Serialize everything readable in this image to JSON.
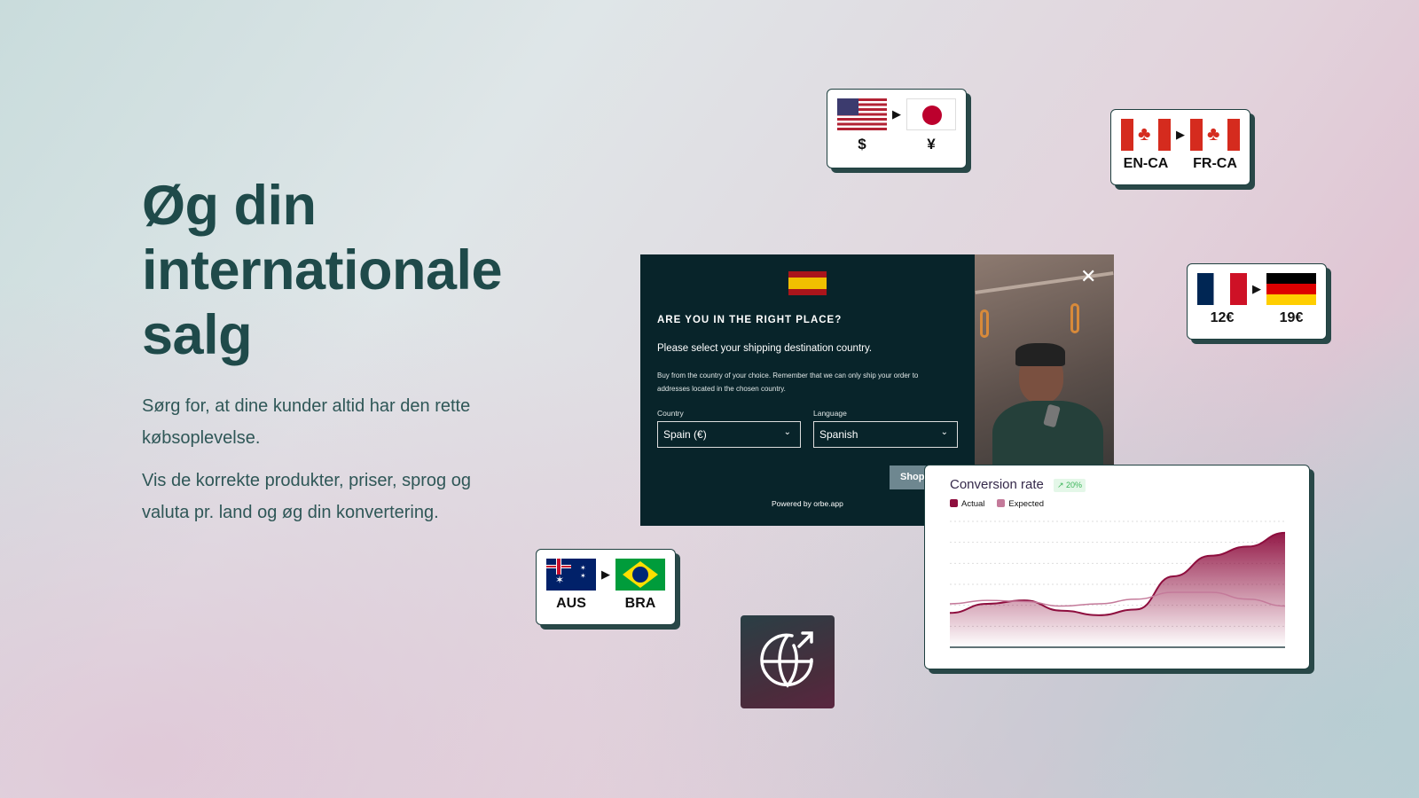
{
  "hero": {
    "title_lines": [
      "Øg din",
      "internationale",
      "salg"
    ],
    "paragraph1": "Sørg for, at dine kunder altid har den rette købsoplevelse.",
    "paragraph2": "Vis de korrekte produkter, priser, sprog og valuta pr. land og øg din konvertering."
  },
  "cards": {
    "usd_jpy": {
      "from": "$",
      "to": "¥",
      "from_flag": "us-flag",
      "to_flag": "japan-flag"
    },
    "en_fr_ca": {
      "from": "EN-CA",
      "to": "FR-CA",
      "from_flag": "canada-flag",
      "to_flag": "canada-flag"
    },
    "fr_de": {
      "from": "12€",
      "to": "19€",
      "from_flag": "france-flag",
      "to_flag": "germany-flag"
    },
    "aus_bra": {
      "from": "AUS",
      "to": "BRA",
      "from_flag": "australia-flag",
      "to_flag": "brazil-flag"
    }
  },
  "modal": {
    "flag": "spain-flag",
    "heading": "ARE YOU IN THE RIGHT PLACE?",
    "subtitle": "Please select your shipping destination country.",
    "body": "Buy from the country of your choice. Remember that we can only ship your order to addresses located in the chosen country.",
    "country_label": "Country",
    "country_value": "Spain (€)",
    "language_label": "Language",
    "language_value": "Spanish",
    "shop_button": "Shop",
    "powered_by": "Powered by orbe.app"
  },
  "chart_data": {
    "type": "area",
    "title": "Conversion rate",
    "badge": "20%",
    "series": [
      {
        "name": "Actual",
        "color": "#8e0e3e",
        "values": [
          30,
          38,
          41,
          32,
          28,
          33,
          62,
          80,
          88,
          100
        ]
      },
      {
        "name": "Expected",
        "color": "#c47a9a",
        "values": [
          38,
          41,
          40,
          36,
          38,
          42,
          48,
          48,
          42,
          36
        ]
      }
    ],
    "grid": true,
    "legend": "top-left",
    "ylim": [
      0,
      110
    ]
  },
  "colors": {
    "accent": "#1f4a4a",
    "modal_bg": "#08242a",
    "actual": "#8e0e3e",
    "expected": "#c47a9a",
    "badge": "#3cb55a"
  }
}
